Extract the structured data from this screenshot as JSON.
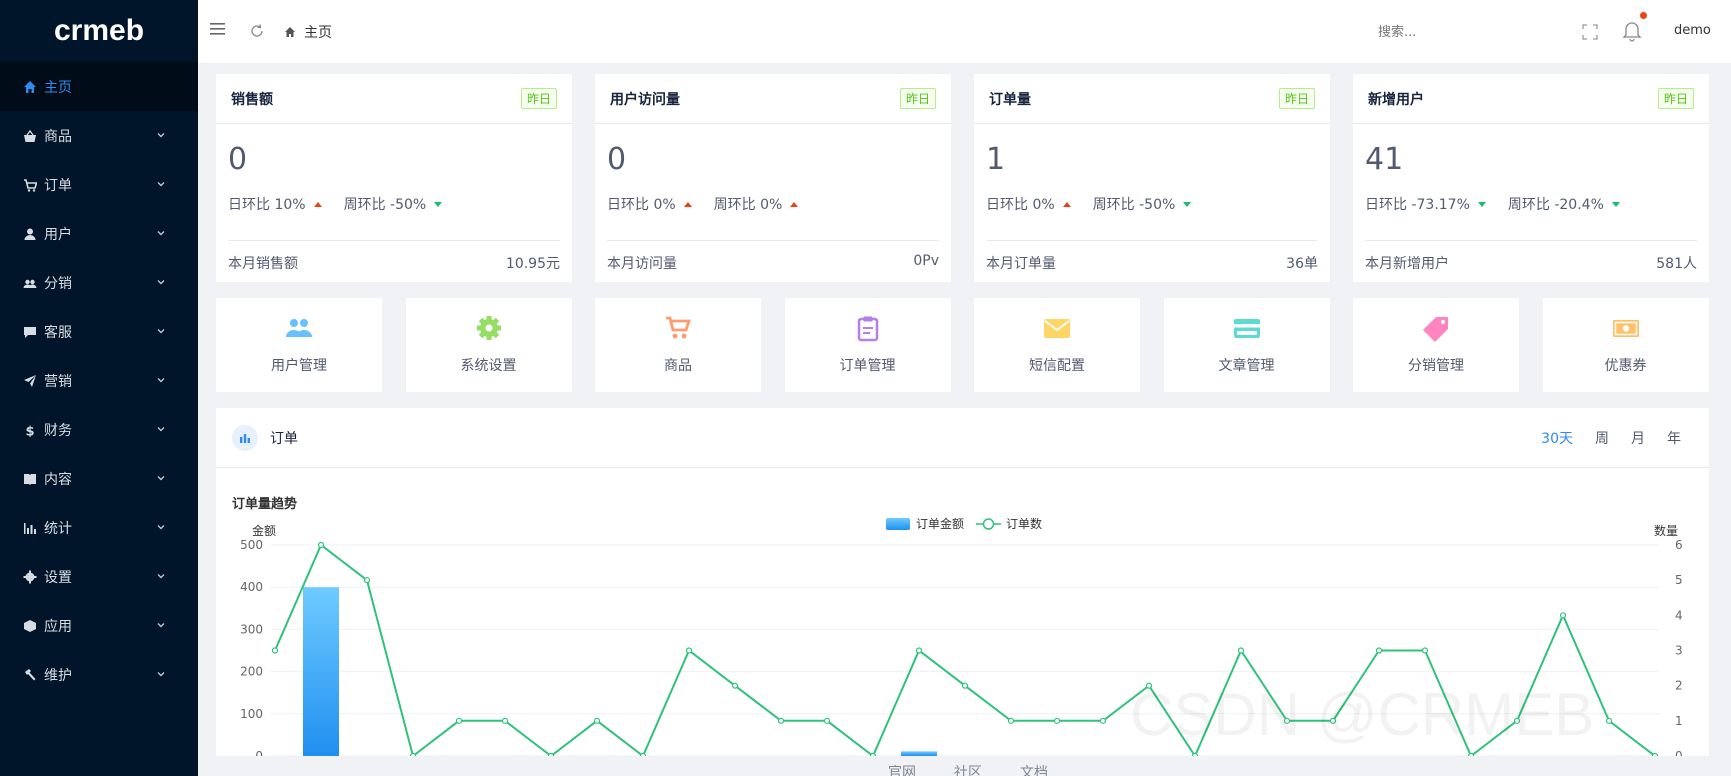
{
  "brand": {
    "logo_text": "crmeb"
  },
  "sidebar": {
    "items": [
      {
        "label": "主页",
        "icon": "home-icon",
        "active": true
      },
      {
        "label": "商品",
        "icon": "basket-icon"
      },
      {
        "label": "订单",
        "icon": "cart-icon"
      },
      {
        "label": "用户",
        "icon": "user-icon"
      },
      {
        "label": "分销",
        "icon": "group-icon"
      },
      {
        "label": "客服",
        "icon": "chat-icon"
      },
      {
        "label": "营销",
        "icon": "send-icon"
      },
      {
        "label": "财务",
        "icon": "dollar-icon"
      },
      {
        "label": "内容",
        "icon": "book-icon"
      },
      {
        "label": "统计",
        "icon": "bar-chart-icon"
      },
      {
        "label": "设置",
        "icon": "gear-icon"
      },
      {
        "label": "应用",
        "icon": "cube-icon"
      },
      {
        "label": "维护",
        "icon": "hammer-icon"
      }
    ]
  },
  "header": {
    "breadcrumb": "主页",
    "search_placeholder": "搜索...",
    "username": "demo"
  },
  "stats": [
    {
      "title": "销售额",
      "tag": "昨日",
      "value": "0",
      "day_label": "日环比 10%",
      "day_trend": "up",
      "week_label": "周环比 -50%",
      "week_trend": "down",
      "footer_label": "本月销售额",
      "footer_value": "10.95元"
    },
    {
      "title": "用户访问量",
      "tag": "昨日",
      "value": "0",
      "day_label": "日环比 0%",
      "day_trend": "up",
      "week_label": "周环比 0%",
      "week_trend": "up",
      "footer_label": "本月访问量",
      "footer_value": "0Pv"
    },
    {
      "title": "订单量",
      "tag": "昨日",
      "value": "1",
      "day_label": "日环比 0%",
      "day_trend": "up",
      "week_label": "周环比 -50%",
      "week_trend": "down",
      "footer_label": "本月订单量",
      "footer_value": "36单"
    },
    {
      "title": "新增用户",
      "tag": "昨日",
      "value": "41",
      "day_label": "日环比 -73.17%",
      "day_trend": "down",
      "week_label": "周环比 -20.4%",
      "week_trend": "down",
      "footer_label": "本月新增用户",
      "footer_value": "581人"
    }
  ],
  "quick_links": [
    {
      "label": "用户管理",
      "icon": "users-icon",
      "color": "#69c0ff"
    },
    {
      "label": "系统设置",
      "icon": "gear-icon",
      "color": "#95de64"
    },
    {
      "label": "商品",
      "icon": "cart-icon",
      "color": "#ff9c6e"
    },
    {
      "label": "订单管理",
      "icon": "clipboard-icon",
      "color": "#b37feb"
    },
    {
      "label": "短信配置",
      "icon": "mail-icon",
      "color": "#ffd666"
    },
    {
      "label": "文章管理",
      "icon": "card-icon",
      "color": "#5cdbd3"
    },
    {
      "label": "分销管理",
      "icon": "tag-icon",
      "color": "#ff85c0"
    },
    {
      "label": "优惠券",
      "icon": "coupon-icon",
      "color": "#ffc069"
    }
  ],
  "order_panel": {
    "title": "订单",
    "ranges": [
      "30天",
      "周",
      "月",
      "年"
    ],
    "active_range": "30天"
  },
  "chart_data": {
    "type": "bar+line",
    "title": "订单量趋势",
    "legend": [
      "订单金额",
      "订单数"
    ],
    "legend_position": "top-center",
    "y_left_label": "金额",
    "y_right_label": "数量",
    "y_left_ticks": [
      "500",
      "400",
      "300",
      "200",
      "100",
      "0"
    ],
    "y_right_ticks": [
      "6",
      "5",
      "4",
      "3",
      "2",
      "1",
      "0"
    ],
    "y_left_range": [
      0,
      500
    ],
    "y_right_range": [
      0,
      6
    ],
    "series": [
      {
        "name": "订单金额",
        "type": "bar",
        "values": [
          0,
          400,
          0,
          0,
          0,
          0,
          0,
          0,
          0,
          0,
          0,
          0,
          0,
          0,
          10.95,
          0,
          0,
          0,
          0,
          0,
          0,
          0,
          0,
          0,
          0,
          0,
          0,
          0,
          0,
          0,
          0
        ]
      },
      {
        "name": "订单数",
        "type": "line",
        "values": [
          3,
          6,
          5,
          0,
          1,
          1,
          0,
          1,
          0,
          3,
          2,
          1,
          1,
          0,
          3,
          2,
          1,
          1,
          1,
          2,
          0,
          3,
          1,
          1,
          3,
          3,
          0,
          1,
          4,
          1,
          0
        ]
      }
    ]
  },
  "watermark": "CSDN @CRMEB",
  "footer": {
    "links": [
      "官网",
      "社区",
      "文档"
    ]
  },
  "colors": {
    "sidebar_bg": "#001529",
    "accent": "#2d8cf0",
    "line": "#2fc27b",
    "bar": "#35a3f5"
  }
}
